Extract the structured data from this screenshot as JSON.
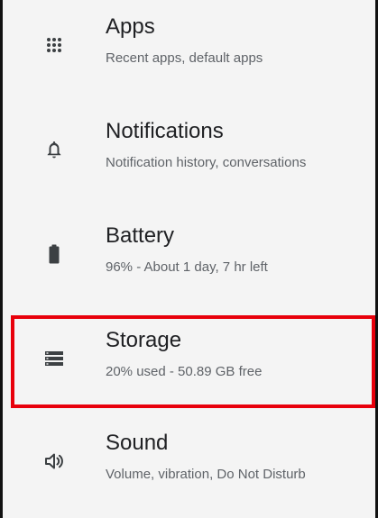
{
  "settings": {
    "items": [
      {
        "title": "Apps",
        "subtitle": "Recent apps, default apps",
        "icon": "apps-grid-icon"
      },
      {
        "title": "Notifications",
        "subtitle": "Notification history, conversations",
        "icon": "bell-icon"
      },
      {
        "title": "Battery",
        "subtitle": "96% - About 1 day, 7 hr left",
        "icon": "battery-icon"
      },
      {
        "title": "Storage",
        "subtitle": "20% used - 50.89 GB free",
        "icon": "storage-icon"
      },
      {
        "title": "Sound",
        "subtitle": "Volume, vibration, Do Not Disturb",
        "icon": "volume-icon"
      }
    ]
  },
  "colors": {
    "highlight": "#e8000b",
    "title": "#202124",
    "subtitle": "#5f6368",
    "icon": "#3c4043"
  }
}
